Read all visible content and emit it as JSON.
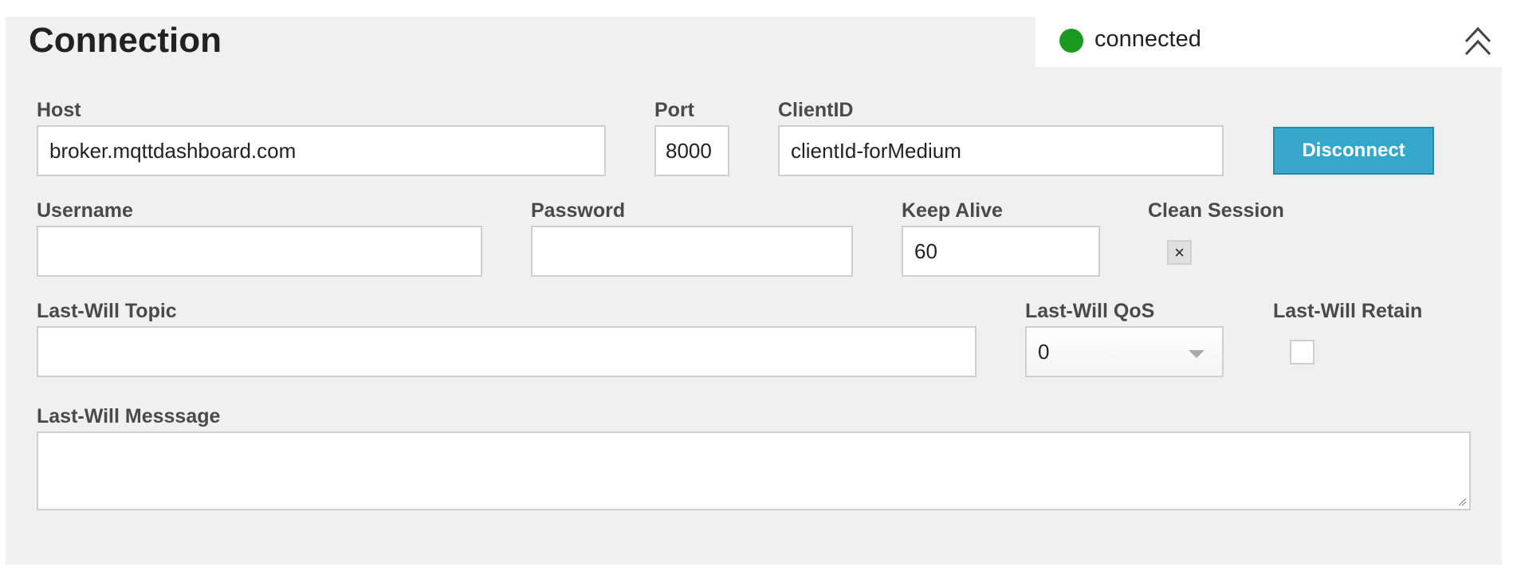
{
  "header": {
    "title": "Connection",
    "status": "connected",
    "status_color": "#1a9a1f",
    "collapse_icon": "double-chevron-up-icon"
  },
  "form": {
    "host": {
      "label": "Host",
      "value": "broker.mqttdashboard.com"
    },
    "port": {
      "label": "Port",
      "value": "8000"
    },
    "client_id": {
      "label": "ClientID",
      "value": "clientId-forMedium"
    },
    "disconnect_label": "Disconnect",
    "username": {
      "label": "Username",
      "value": ""
    },
    "password": {
      "label": "Password",
      "value": ""
    },
    "keep_alive": {
      "label": "Keep Alive",
      "value": "60"
    },
    "clean_session": {
      "label": "Clean Session",
      "checked": true,
      "mark": "×"
    },
    "lw_topic": {
      "label": "Last-Will Topic",
      "value": ""
    },
    "lw_qos": {
      "label": "Last-Will QoS",
      "value": "0"
    },
    "lw_retain": {
      "label": "Last-Will Retain",
      "checked": false
    },
    "lw_message": {
      "label": "Last-Will Messsage",
      "value": ""
    }
  },
  "colors": {
    "accent": "#34a7cb",
    "panel": "#f0f0f0"
  }
}
